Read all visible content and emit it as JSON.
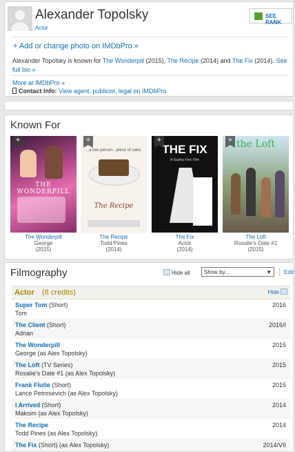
{
  "header": {
    "name": "Alexander Topolsky",
    "role": "Actor",
    "see_rank": "SEE RANK",
    "add_photo": "+ Add or change photo on IMDbPro »",
    "bio_prefix": "Alexander Topolsky is known for ",
    "bio_t1": "The Wonderpill",
    "bio_y1": " (2015), ",
    "bio_t2": "The Recipe",
    "bio_y2": " (2014) and ",
    "bio_t3": "The Fix",
    "bio_y3": " (2014). ",
    "bio_more": "See full bio »",
    "more_imdbpro": "More at IMDbPro »",
    "contact_label": "Contact Info:",
    "contact_value": " View agent, publicist, legal on IMDbPro"
  },
  "known_for": {
    "title": "Known For",
    "items": [
      {
        "title": "The Wonderpill",
        "character": "George",
        "year": "(2015)",
        "poster_text": "THE WONDERPILL"
      },
      {
        "title": "The Recipe",
        "character": "Todd Pines",
        "year": "(2014)",
        "poster_text": "The Recipe",
        "poster_tagline": "...a two person...piece of cake."
      },
      {
        "title": "The Fix",
        "character": "Actor",
        "year": "(2014)",
        "poster_text": "THE FIX",
        "poster_sub": "A Sophia Fine Film"
      },
      {
        "title": "The Loft",
        "character": "Rosalie's Date #1",
        "year": "(2015)",
        "poster_text": "the Loft"
      }
    ]
  },
  "filmography": {
    "title": "Filmography",
    "hide_all": "Hide all",
    "show_by": "Show by...",
    "edit": "Edit",
    "section_label": "Actor",
    "section_count": "(8 credits)",
    "hide": "Hide",
    "rows": [
      {
        "title": "Super Tom",
        "type": " (Short)",
        "character": "Tom",
        "year": "2016"
      },
      {
        "title": "The Client",
        "type": " (Short)",
        "character": "Adrian",
        "year": "2016/I"
      },
      {
        "title": "The Wonderpill",
        "type": "",
        "character": "George (as Alex Topolsky)",
        "year": "2015"
      },
      {
        "title": "The Loft",
        "type": " (TV Series)",
        "character": "Rosalie's Date #1 (as Alex Topolsky)",
        "year": "2015"
      },
      {
        "title": "Frank Flutie",
        "type": " (Short)",
        "character": "Lance Petrosevich (as Alex Topolsky)",
        "year": "2015"
      },
      {
        "title": "I Arrived",
        "type": " (Short)",
        "character": "Maksim (as Alex Topolsky)",
        "year": "2014"
      },
      {
        "title": "The Recipe",
        "type": "",
        "character": "Todd Pines (as Alex Topolsky)",
        "year": "2014"
      },
      {
        "title": "The Fix",
        "type": " (Short) (as Alex Topolsky)",
        "character": "",
        "year": "2014/VII"
      }
    ]
  }
}
